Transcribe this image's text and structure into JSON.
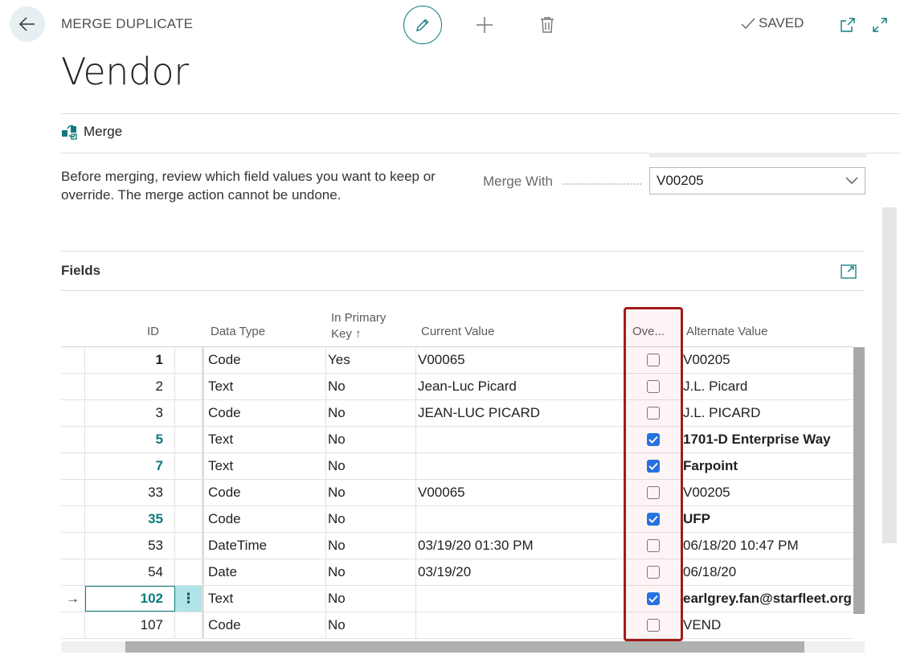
{
  "header": {
    "caption": "MERGE DUPLICATE",
    "title": "Vendor",
    "saved_label": "SAVED"
  },
  "actions": {
    "merge_label": "Merge"
  },
  "form": {
    "instructions": "Before merging, review which field values you want to keep or override. The merge action cannot be undone.",
    "merge_with_label": "Merge With",
    "merge_with_value": "V00205"
  },
  "fields": {
    "title": "Fields",
    "columns": {
      "id": "ID",
      "data_type": "Data Type",
      "primary_key_line1": "In Primary",
      "primary_key_line2": "Key",
      "primary_key_sort": "↑",
      "current_value": "Current Value",
      "override": "Ove...",
      "alternate_value": "Alternate Value"
    },
    "rows": [
      {
        "id": "1",
        "data_type": "Code",
        "primary_key": "Yes",
        "current_value": "V00065",
        "override": false,
        "alternate_value": "V00205",
        "style": "bold"
      },
      {
        "id": "2",
        "data_type": "Text",
        "primary_key": "No",
        "current_value": "Jean-Luc Picard",
        "override": false,
        "alternate_value": "J.L. Picard",
        "style": "normal"
      },
      {
        "id": "3",
        "data_type": "Code",
        "primary_key": "No",
        "current_value": "JEAN-LUC PICARD",
        "override": false,
        "alternate_value": "J.L. PICARD",
        "style": "normal"
      },
      {
        "id": "5",
        "data_type": "Text",
        "primary_key": "No",
        "current_value": "",
        "override": true,
        "alternate_value": "1701-D Enterprise Way",
        "style": "teal"
      },
      {
        "id": "7",
        "data_type": "Text",
        "primary_key": "No",
        "current_value": "",
        "override": true,
        "alternate_value": "Farpoint",
        "style": "teal"
      },
      {
        "id": "33",
        "data_type": "Code",
        "primary_key": "No",
        "current_value": "V00065",
        "override": false,
        "alternate_value": "V00205",
        "style": "normal"
      },
      {
        "id": "35",
        "data_type": "Code",
        "primary_key": "No",
        "current_value": "",
        "override": true,
        "alternate_value": "UFP",
        "style": "teal"
      },
      {
        "id": "53",
        "data_type": "DateTime",
        "primary_key": "No",
        "current_value": "03/19/20 01:30 PM",
        "override": false,
        "alternate_value": "06/18/20 10:47 PM",
        "style": "normal"
      },
      {
        "id": "54",
        "data_type": "Date",
        "primary_key": "No",
        "current_value": "03/19/20",
        "override": false,
        "alternate_value": "06/18/20",
        "style": "normal"
      },
      {
        "id": "102",
        "data_type": "Text",
        "primary_key": "No",
        "current_value": "",
        "override": true,
        "alternate_value": "earlgrey.fan@starfleet.org",
        "style": "teal",
        "current": true
      },
      {
        "id": "107",
        "data_type": "Code",
        "primary_key": "No",
        "current_value": "",
        "override": false,
        "alternate_value": "VEND",
        "style": "normal"
      }
    ]
  },
  "row_indicator": "→",
  "row_menu": "⋮",
  "colors": {
    "accent": "#0f7a7f",
    "checkbox": "#1a73e8",
    "highlight": "#a31b1b"
  }
}
